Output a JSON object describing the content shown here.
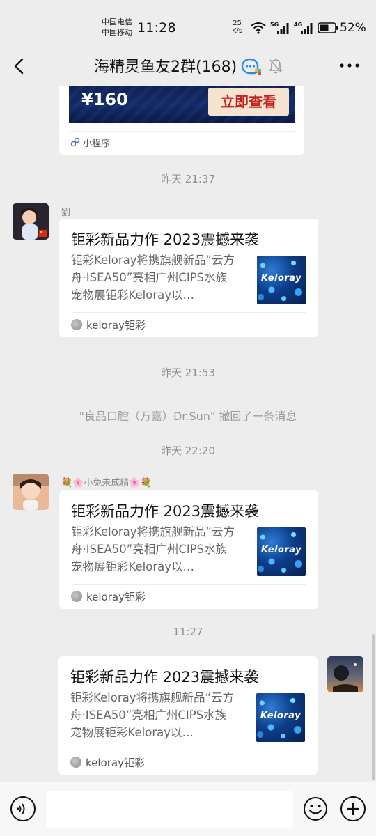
{
  "status_bar": {
    "carrier_1": "中国电信",
    "carrier_2": "中国移动",
    "time": "11:28",
    "net_speed_value": "25",
    "net_speed_unit": "K/s",
    "signal_1_label": "5G",
    "signal_2_label": "4G",
    "battery": "52%"
  },
  "header": {
    "title": "海精灵鱼友2群(168)",
    "icons": [
      "back-arrow-icon",
      "group-chat-badge-icon",
      "muted-bell-icon",
      "more-icon"
    ]
  },
  "messages": {
    "mini_program": {
      "price": "¥160",
      "button": "立即查看",
      "source": "小程序"
    },
    "ts_1": "昨天 21:37",
    "msg_1": {
      "sender": "劉",
      "title": "钜彩新品力作 2023震撼来袭",
      "desc": "钜彩Keloray将携旗舰新品“云方舟·ISEA50”亮相广州CIPS水族宠物展钜彩Keloray以…",
      "thumb_brand": "Keloray",
      "source": "keloray钜彩"
    },
    "ts_2": "昨天 21:53",
    "recall": "\"良品口腔（万嘉）Dr.Sun\" 撤回了一条消息",
    "ts_3": "昨天 22:20",
    "msg_2": {
      "sender": "💐🌸小兔未成精🌸💐",
      "title": "钜彩新品力作 2023震撼来袭",
      "desc": "钜彩Keloray将携旗舰新品“云方舟·ISEA50”亮相广州CIPS水族宠物展钜彩Keloray以…",
      "thumb_brand": "Keloray",
      "source": "keloray钜彩"
    },
    "ts_4": "11:27",
    "msg_3": {
      "title": "钜彩新品力作 2023震撼来袭",
      "desc": "钜彩Keloray将携旗舰新品“云方舟·ISEA50”亮相广州CIPS水族宠物展钜彩Keloray以…",
      "thumb_brand": "Keloray",
      "source": "keloray钜彩"
    }
  },
  "input_bar": {
    "icons": [
      "voice-icon",
      "emoji-icon",
      "plus-icon"
    ]
  },
  "colors": {
    "background": "#ededed",
    "bubble": "#ffffff",
    "timestamp_text": "#8f8f8f",
    "mini_button_text": "#c3201c"
  }
}
